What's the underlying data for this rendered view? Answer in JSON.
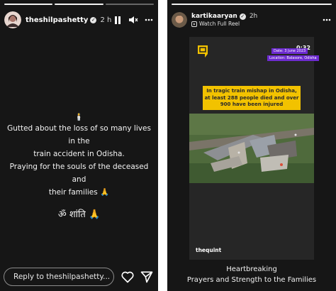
{
  "left_story": {
    "username": "theshilpashetty",
    "time": "2 h",
    "caption_lines": [
      "Gutted about the loss of so many lives in the",
      "train accident in Odisha.",
      "Praying for the souls of the deceased and",
      "their families 🙏"
    ],
    "om_line": "ॐ शांति 🙏",
    "reply_placeholder": "Reply to theshilpashetty...",
    "icons": [
      "pause-icon",
      "mute-icon",
      "more-icon",
      "heart-icon",
      "send-icon"
    ]
  },
  "right_story": {
    "username": "kartikaaryan",
    "time": "2h",
    "watch_label": "Watch Full Reel",
    "reel": {
      "duration": "0:32",
      "date_tag": "Date: 3 June 2023",
      "location_tag": "Location: Balasore, Odisha",
      "headline": "In tragic train mishap in Odisha, at least 288 people died and over 900 have been injured",
      "source": "thequint"
    },
    "caption_lines": [
      "Heartbreaking",
      "Prayers and Strength to the Families"
    ],
    "icons": [
      "more-icon"
    ]
  },
  "colors": {
    "story_bg": "#161616",
    "tag_purple": "#6d2bd0",
    "headline_yellow": "#f2c200",
    "page_bg": "#ffffff"
  }
}
